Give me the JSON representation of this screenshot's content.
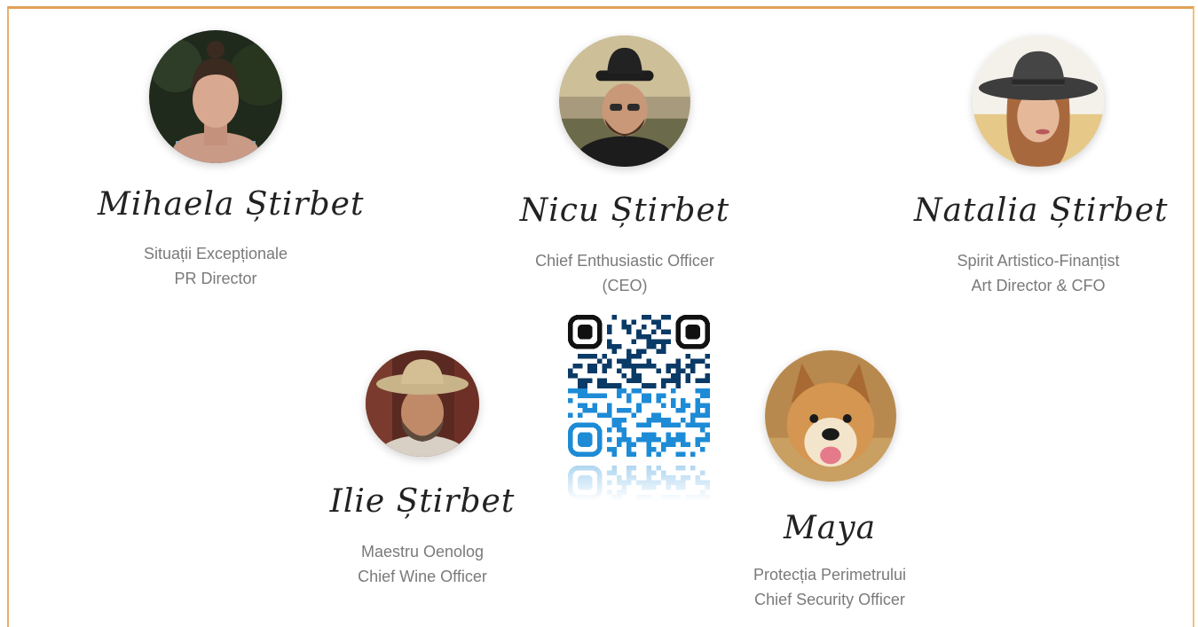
{
  "team": [
    {
      "name": "Mihaela Știrbet",
      "role_line1": "Situații Excepționale",
      "role_line2": "PR Director"
    },
    {
      "name": "Nicu Știrbet",
      "role_line1": "Chief Enthusiastic Officer",
      "role_line2": "(CEO)"
    },
    {
      "name": "Natalia Știrbet",
      "role_line1": "Spirit Artistico-Finanțist",
      "role_line2": "Art Director & CFO"
    },
    {
      "name": "Ilie Știrbet",
      "role_line1": "Maestru Oenolog",
      "role_line2": "Chief Wine Officer"
    },
    {
      "name": "Maya",
      "role_line1": "Protecția Perimetrului",
      "role_line2": "Chief Security Officer"
    }
  ],
  "colors": {
    "frame_border": "#e3a25a",
    "name_text": "#222222",
    "role_text": "#7a7a7a",
    "qr_dark": "#0a3a66",
    "qr_accent": "#1e8bd6"
  },
  "icons": {
    "qr_code": "qr-code-icon"
  }
}
